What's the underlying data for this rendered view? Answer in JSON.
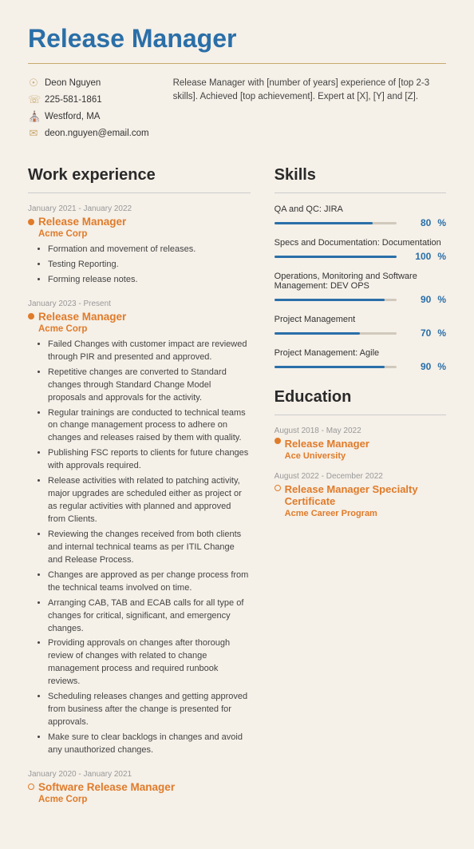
{
  "header": {
    "title": "Release Manager",
    "name": "Deon Nguyen",
    "phone": "225-581-1861",
    "location": "Westford, MA",
    "email": "deon.nguyen@email.com",
    "summary": "Release Manager with [number of years] experience of [top 2-3 skills]. Achieved [top achievement]. Expert at [X], [Y] and [Z]."
  },
  "work_experience": {
    "section_title": "Work experience",
    "jobs": [
      {
        "date": "January 2021 - January 2022",
        "title": "Release Manager",
        "company": "Acme Corp",
        "bullet_type": "filled",
        "bullets": [
          "Formation and movement of releases.",
          "Testing Reporting.",
          "Forming release notes."
        ]
      },
      {
        "date": "January 2023 - Present",
        "title": "Release Manager",
        "company": "Acme Corp",
        "bullet_type": "filled",
        "bullets": [
          "Failed Changes with customer impact are reviewed through PIR and presented and approved.",
          "Repetitive changes are converted to Standard changes through Standard Change Model proposals and approvals for the activity.",
          "Regular trainings are conducted to technical teams on change management process to adhere on changes and releases raised by them with quality.",
          "Publishing FSC reports to clients for future changes with approvals required.",
          "Release activities with related to patching activity, major upgrades are scheduled either as project or as regular activities with planned and approved from Clients.",
          "Reviewing the changes received from both clients and internal technical teams as per ITIL Change and Release Process.",
          "Changes are approved as per change process from the technical teams involved on time.",
          "Arranging CAB, TAB and ECAB calls for all type of changes for critical, significant, and emergency changes.",
          "Providing approvals on changes after thorough review of changes with related to change management process and required runbook reviews.",
          "Scheduling releases changes and getting approved from business after the change is presented for approvals.",
          "Make sure to clear backlogs in changes and avoid any unauthorized changes."
        ]
      },
      {
        "date": "January 2020 - January 2021",
        "title": "Software Release Manager",
        "company": "Acme Corp",
        "bullet_type": "hollow",
        "bullets": []
      }
    ]
  },
  "skills": {
    "section_title": "Skills",
    "items": [
      {
        "label": "QA and QC: JIRA",
        "pct": 80
      },
      {
        "label": "Specs and Documentation: Documentation",
        "pct": 100
      },
      {
        "label": "Operations, Monitoring and Software Management: DEV OPS",
        "pct": 90
      },
      {
        "label": "Project Management",
        "pct": 70
      },
      {
        "label": "Project Management: Agile",
        "pct": 90
      }
    ]
  },
  "education": {
    "section_title": "Education",
    "entries": [
      {
        "date": "August 2018 - May 2022",
        "title": "Release Manager",
        "school": "Ace University",
        "bullet_type": "filled"
      },
      {
        "date": "August 2022 - December 2022",
        "title": "Release Manager Specialty Certificate",
        "school": "Acme Career Program",
        "bullet_type": "hollow"
      }
    ]
  }
}
